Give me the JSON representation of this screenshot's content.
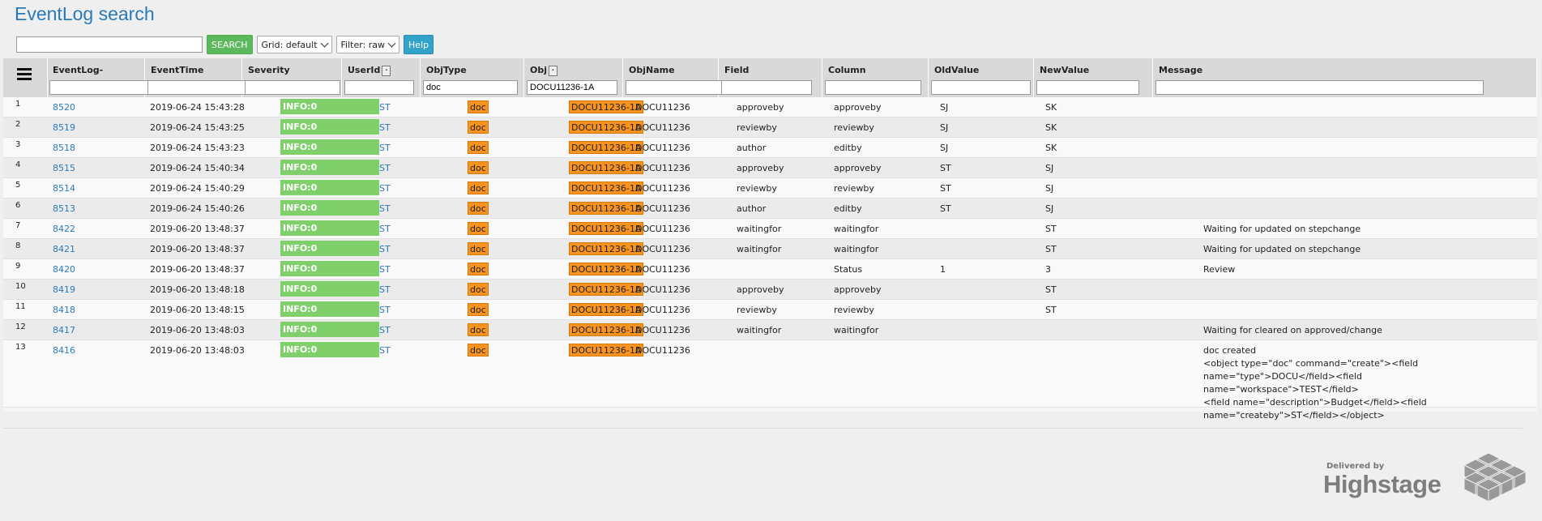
{
  "app": {
    "title": "EventLog search"
  },
  "toolbar": {
    "search_value": "",
    "search_label": "SEARCH",
    "grid_select": "Grid: default",
    "filter_select": "Filter: raw",
    "help_label": "Help"
  },
  "columns": [
    {
      "key": "eventlog",
      "label": "EventLog-",
      "filter": ""
    },
    {
      "key": "eventtime",
      "label": "EventTime",
      "filter": ""
    },
    {
      "key": "severity",
      "label": "Severity",
      "filter": ""
    },
    {
      "key": "userid",
      "label": "UserId",
      "filter": ""
    },
    {
      "key": "objtype",
      "label": "ObjType",
      "filter": "doc"
    },
    {
      "key": "obj",
      "label": "Obj",
      "filter": "DOCU11236-1A"
    },
    {
      "key": "objname",
      "label": "ObjName",
      "filter": ""
    },
    {
      "key": "field",
      "label": "Field",
      "filter": ""
    },
    {
      "key": "column",
      "label": "Column",
      "filter": ""
    },
    {
      "key": "oldvalue",
      "label": "OldValue",
      "filter": ""
    },
    {
      "key": "newvalue",
      "label": "NewValue",
      "filter": ""
    },
    {
      "key": "message",
      "label": "Message",
      "filter": ""
    }
  ],
  "rows": [
    {
      "n": "1",
      "id": "8520",
      "time": "2019-06-24 15:43:28",
      "sev": "INFO:0",
      "user": "ST",
      "type": "doc",
      "obj": "DOCU11236-1A",
      "name": "DOCU11236",
      "field": "approveby",
      "column": "approveby",
      "old": "SJ",
      "new": "SK",
      "msg": ""
    },
    {
      "n": "2",
      "id": "8519",
      "time": "2019-06-24 15:43:25",
      "sev": "INFO:0",
      "user": "ST",
      "type": "doc",
      "obj": "DOCU11236-1A",
      "name": "DOCU11236",
      "field": "reviewby",
      "column": "reviewby",
      "old": "SJ",
      "new": "SK",
      "msg": ""
    },
    {
      "n": "3",
      "id": "8518",
      "time": "2019-06-24 15:43:23",
      "sev": "INFO:0",
      "user": "ST",
      "type": "doc",
      "obj": "DOCU11236-1A",
      "name": "DOCU11236",
      "field": "author",
      "column": "editby",
      "old": "SJ",
      "new": "SK",
      "msg": ""
    },
    {
      "n": "4",
      "id": "8515",
      "time": "2019-06-24 15:40:34",
      "sev": "INFO:0",
      "user": "ST",
      "type": "doc",
      "obj": "DOCU11236-1A",
      "name": "DOCU11236",
      "field": "approveby",
      "column": "approveby",
      "old": "ST",
      "new": "SJ",
      "msg": ""
    },
    {
      "n": "5",
      "id": "8514",
      "time": "2019-06-24 15:40:29",
      "sev": "INFO:0",
      "user": "ST",
      "type": "doc",
      "obj": "DOCU11236-1A",
      "name": "DOCU11236",
      "field": "reviewby",
      "column": "reviewby",
      "old": "ST",
      "new": "SJ",
      "msg": ""
    },
    {
      "n": "6",
      "id": "8513",
      "time": "2019-06-24 15:40:26",
      "sev": "INFO:0",
      "user": "ST",
      "type": "doc",
      "obj": "DOCU11236-1A",
      "name": "DOCU11236",
      "field": "author",
      "column": "editby",
      "old": "ST",
      "new": "SJ",
      "msg": ""
    },
    {
      "n": "7",
      "id": "8422",
      "time": "2019-06-20 13:48:37",
      "sev": "INFO:0",
      "user": "ST",
      "type": "doc",
      "obj": "DOCU11236-1A",
      "name": "DOCU11236",
      "field": "waitingfor",
      "column": "waitingfor",
      "old": "",
      "new": "ST",
      "msg": "Waiting for updated on stepchange"
    },
    {
      "n": "8",
      "id": "8421",
      "time": "2019-06-20 13:48:37",
      "sev": "INFO:0",
      "user": "ST",
      "type": "doc",
      "obj": "DOCU11236-1A",
      "name": "DOCU11236",
      "field": "waitingfor",
      "column": "waitingfor",
      "old": "",
      "new": "ST",
      "msg": "Waiting for updated on stepchange"
    },
    {
      "n": "9",
      "id": "8420",
      "time": "2019-06-20 13:48:37",
      "sev": "INFO:0",
      "user": "ST",
      "type": "doc",
      "obj": "DOCU11236-1A",
      "name": "DOCU11236",
      "field": "",
      "column": "Status",
      "old": "1",
      "new": "3",
      "msg": "Review"
    },
    {
      "n": "10",
      "id": "8419",
      "time": "2019-06-20 13:48:18",
      "sev": "INFO:0",
      "user": "ST",
      "type": "doc",
      "obj": "DOCU11236-1A",
      "name": "DOCU11236",
      "field": "approveby",
      "column": "approveby",
      "old": "",
      "new": "ST",
      "msg": ""
    },
    {
      "n": "11",
      "id": "8418",
      "time": "2019-06-20 13:48:15",
      "sev": "INFO:0",
      "user": "ST",
      "type": "doc",
      "obj": "DOCU11236-1A",
      "name": "DOCU11236",
      "field": "reviewby",
      "column": "reviewby",
      "old": "",
      "new": "ST",
      "msg": ""
    },
    {
      "n": "12",
      "id": "8417",
      "time": "2019-06-20 13:48:03",
      "sev": "INFO:0",
      "user": "ST",
      "type": "doc",
      "obj": "DOCU11236-1A",
      "name": "DOCU11236",
      "field": "waitingfor",
      "column": "waitingfor",
      "old": "",
      "new": "",
      "msg": "Waiting for cleared on approved/change"
    },
    {
      "n": "13",
      "id": "8416",
      "time": "2019-06-20 13:48:03",
      "sev": "INFO:0",
      "user": "ST",
      "type": "doc",
      "obj": "DOCU11236-1A",
      "name": "DOCU11236",
      "field": "",
      "column": "",
      "old": "",
      "new": "",
      "msg": "doc created"
    }
  ],
  "last_row_message_lines": [
    "<object type=\"doc\" command=\"create\"><field",
    "name=\"type\">DOCU</field><field name=\"workspace\">TEST</field>",
    "<field name=\"description\">Budget</field><field",
    "name=\"createby\">ST</field></object>"
  ],
  "footer": {
    "delivered_by": "Delivered by",
    "brand": "Highstage",
    "logo_icon": "cube-stack-icon"
  },
  "colors": {
    "accent": "#2a7ab8",
    "success": "#5cb85c",
    "info_badge": "#7fd06b",
    "orange_badge": "#f7931e",
    "help": "#31a2c8"
  }
}
